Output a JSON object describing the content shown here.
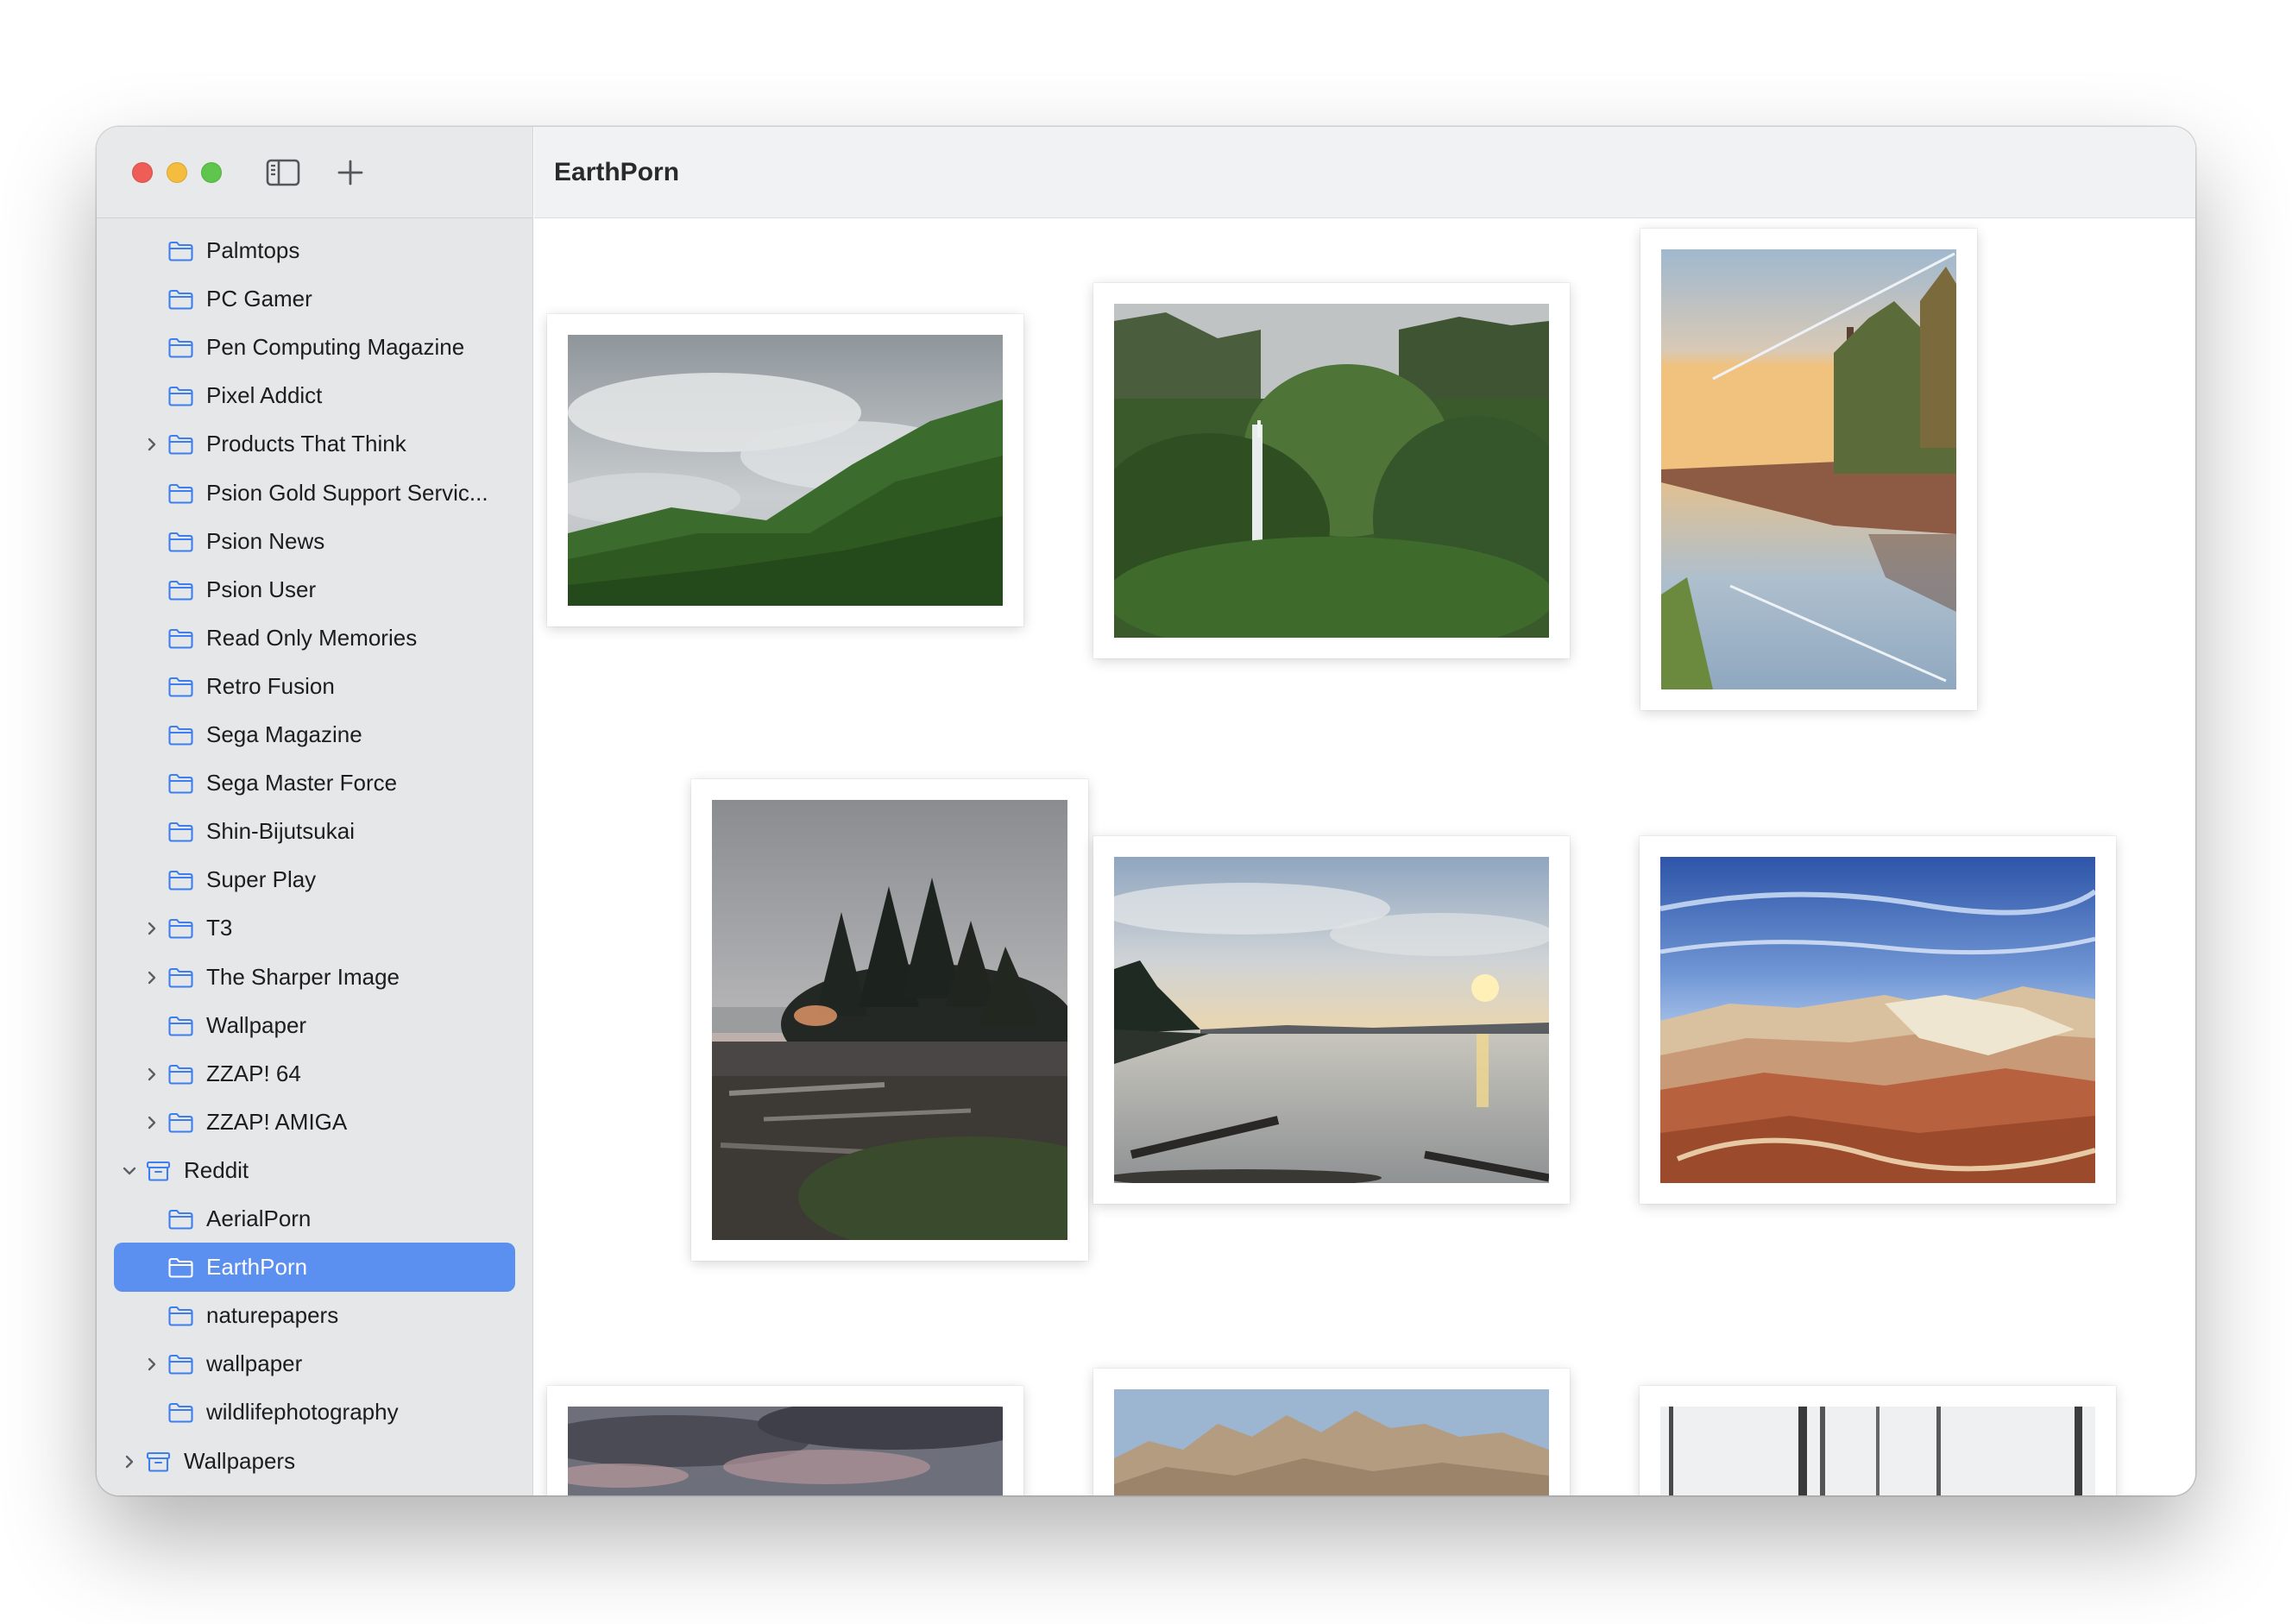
{
  "window": {
    "title": "EarthPorn"
  },
  "toolbar": {
    "sidebar_toggle_icon": "sidebar-toggle-icon",
    "add_icon": "plus-icon"
  },
  "sidebar": {
    "items": [
      {
        "label": "Palmtops",
        "icon": "folder-icon"
      },
      {
        "label": "PC Gamer",
        "icon": "folder-icon"
      },
      {
        "label": "Pen Computing Magazine",
        "icon": "folder-icon"
      },
      {
        "label": "Pixel Addict",
        "icon": "folder-icon"
      },
      {
        "label": "Products That Think",
        "icon": "folder-icon",
        "expandable": true
      },
      {
        "label": "Psion Gold Support Servic...",
        "icon": "folder-icon"
      },
      {
        "label": "Psion News",
        "icon": "folder-icon"
      },
      {
        "label": "Psion User",
        "icon": "folder-icon"
      },
      {
        "label": "Read Only Memories",
        "icon": "folder-icon"
      },
      {
        "label": "Retro Fusion",
        "icon": "folder-icon"
      },
      {
        "label": "Sega Magazine",
        "icon": "folder-icon"
      },
      {
        "label": "Sega Master Force",
        "icon": "folder-icon"
      },
      {
        "label": "Shin-Bijutsukai",
        "icon": "folder-icon"
      },
      {
        "label": "Super Play",
        "icon": "folder-icon"
      },
      {
        "label": "T3",
        "icon": "folder-icon",
        "expandable": true
      },
      {
        "label": "The Sharper Image",
        "icon": "folder-icon",
        "expandable": true
      },
      {
        "label": "Wallpaper",
        "icon": "folder-icon"
      },
      {
        "label": "ZZAP! 64",
        "icon": "folder-icon",
        "expandable": true
      },
      {
        "label": "ZZAP! AMIGA",
        "icon": "folder-icon",
        "expandable": true
      },
      {
        "label": "Reddit",
        "icon": "archive-box-icon",
        "expanded": true,
        "top_level": true
      },
      {
        "label": "AerialPorn",
        "icon": "folder-icon"
      },
      {
        "label": "EarthPorn",
        "icon": "folder-icon",
        "selected": true
      },
      {
        "label": "naturepapers",
        "icon": "folder-icon"
      },
      {
        "label": "wallpaper",
        "icon": "folder-icon",
        "expandable": true
      },
      {
        "label": "wildlifephotography",
        "icon": "folder-icon"
      },
      {
        "label": "Wallpapers",
        "icon": "archive-box-icon",
        "expandable": true,
        "top_level": true
      }
    ]
  },
  "gallery": {
    "photos": [
      {
        "name": "misty-green-mountain-photo"
      },
      {
        "name": "jungle-waterfall-photo"
      },
      {
        "name": "sunset-river-reflection-photo"
      },
      {
        "name": "rocky-coast-trees-photo"
      },
      {
        "name": "lake-sunset-photo"
      },
      {
        "name": "painted-desert-rocks-photo"
      },
      {
        "name": "dusk-clouds-photo"
      },
      {
        "name": "badlands-ridge-photo"
      },
      {
        "name": "bare-tree-trunks-photo"
      }
    ]
  },
  "colors": {
    "accent": "#5b8ff0",
    "folder_icon": "#3d7ef0",
    "sidebar_bg": "#e6e7e9",
    "titlebar_bg": "#f0f2f4"
  }
}
